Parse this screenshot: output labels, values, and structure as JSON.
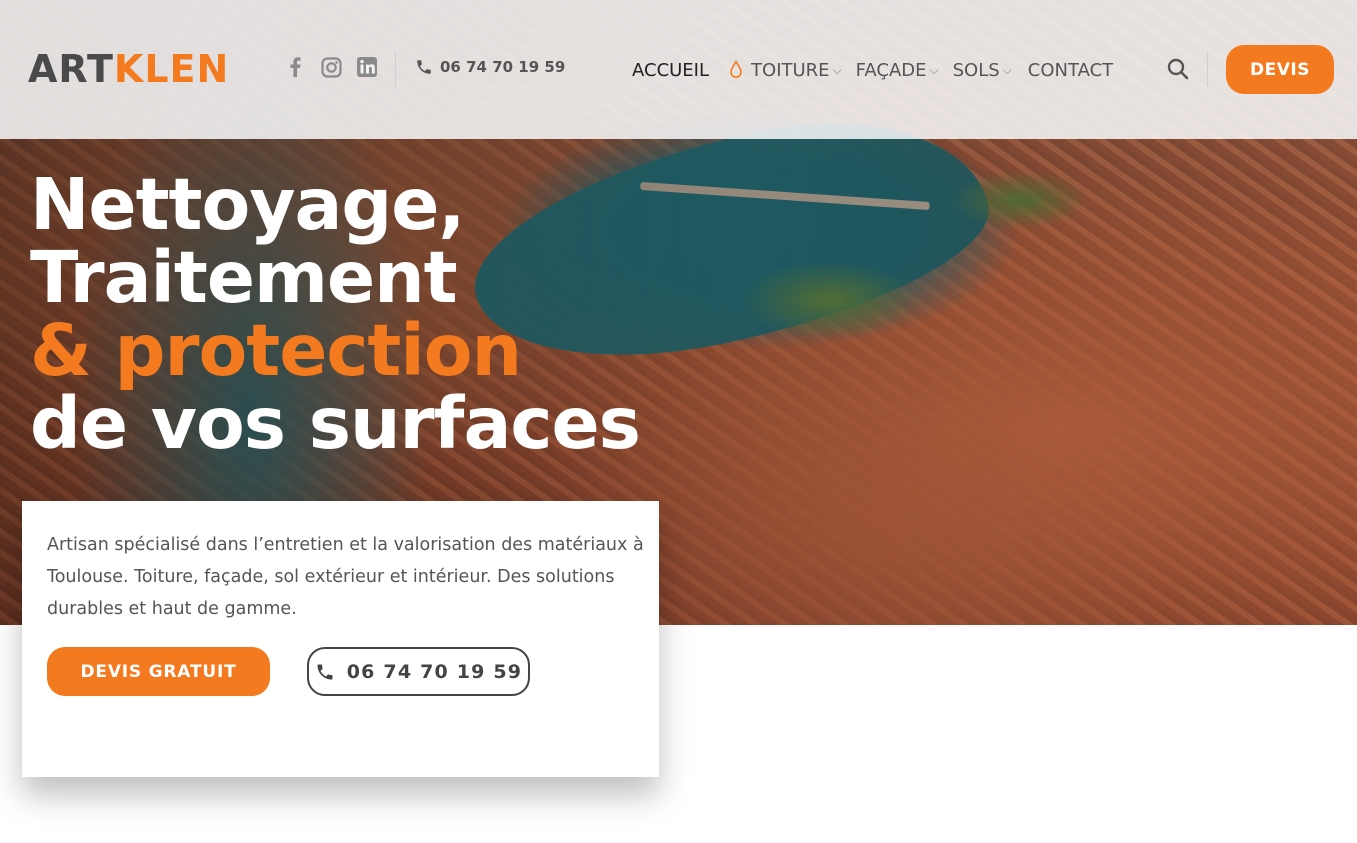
{
  "header": {
    "logo_part1": "ART",
    "logo_part2": "KLEN",
    "social_icons": [
      "facebook-icon",
      "instagram-icon",
      "linkedin-icon"
    ],
    "phone": "06 74 70 19 59",
    "nav": {
      "accueil": "ACCUEIL",
      "toiture": "TOITURE",
      "facade": "FAÇADE",
      "sols": "SOLS",
      "contact": "CONTACT"
    },
    "devis_label": "DEVIS"
  },
  "hero": {
    "line1": "Nettoyage,",
    "line2": "Traitement",
    "line3": "& protection",
    "line4": "de vos surfaces"
  },
  "card": {
    "description": "Artisan spécialisé dans l’entretien et la valorisation des matériaux à Toulouse. Toiture, façade, sol extérieur et intérieur. Des solutions durables et haut de gamme.",
    "cta_devis": "DEVIS GRATUIT",
    "cta_phone": "06 74 70 19 59"
  },
  "colors": {
    "accent": "#f47a20",
    "text_dark": "#222222",
    "text_muted": "#555555"
  }
}
